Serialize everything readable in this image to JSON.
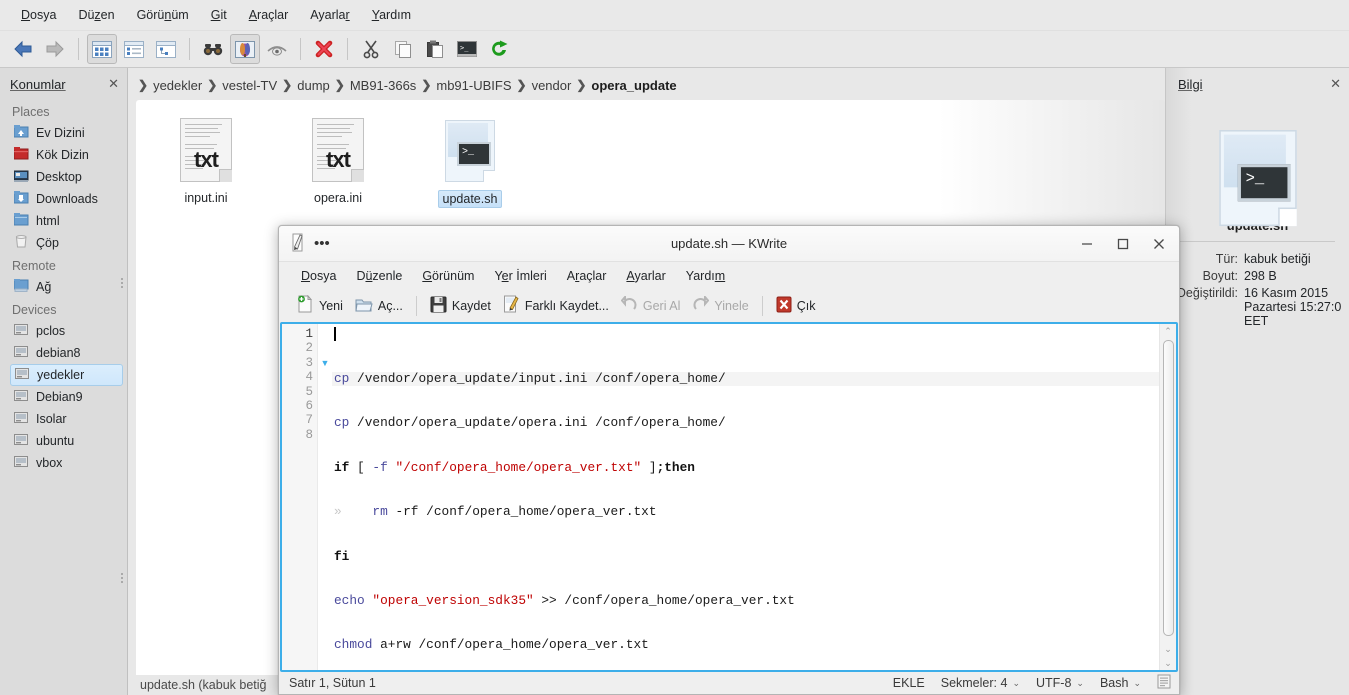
{
  "filemanager": {
    "menubar": [
      "Dosya",
      "Düzen",
      "Görünüm",
      "Git",
      "Araçlar",
      "Ayarlar",
      "Yardım"
    ],
    "toolbar_icons": [
      "back-arrow-icon",
      "forward-arrow-icon",
      "view-icons-icon",
      "view-details-icon",
      "view-columns-icon",
      "find-icon",
      "preview-icon",
      "hidden-files-icon",
      "delete-icon",
      "cut-icon",
      "copy-icon",
      "paste-icon",
      "terminal-icon",
      "reload-icon"
    ],
    "sidebar": {
      "title": "Konumlar",
      "close_label": "✕",
      "groups": [
        {
          "label": "Places",
          "items": [
            {
              "label": "Ev Dizini",
              "icon": "home-folder-icon"
            },
            {
              "label": "Kök Dizin",
              "icon": "root-folder-icon"
            },
            {
              "label": "Desktop",
              "icon": "desktop-folder-icon"
            },
            {
              "label": "Downloads",
              "icon": "downloads-folder-icon"
            },
            {
              "label": "html",
              "icon": "folder-icon"
            },
            {
              "label": "Çöp",
              "icon": "trash-icon"
            }
          ]
        },
        {
          "label": "Remote",
          "items": [
            {
              "label": "Ağ",
              "icon": "network-folder-icon"
            }
          ]
        },
        {
          "label": "Devices",
          "items": [
            {
              "label": "pclos",
              "icon": "harddisk-icon"
            },
            {
              "label": "debian8",
              "icon": "harddisk-icon"
            },
            {
              "label": "yedekler",
              "icon": "harddisk-icon",
              "active": true
            },
            {
              "label": "Debian9",
              "icon": "harddisk-icon"
            },
            {
              "label": "Isolar",
              "icon": "harddisk-icon"
            },
            {
              "label": "ubuntu",
              "icon": "harddisk-icon"
            },
            {
              "label": "vbox",
              "icon": "harddisk-icon"
            }
          ]
        }
      ]
    },
    "breadcrumb": [
      "yedekler",
      "vestel-TV",
      "dump",
      "MB91-366s",
      "mb91-UBIFS",
      "vendor",
      "opera_update"
    ],
    "files": [
      {
        "name": "input.ini",
        "icon": "text-file-icon",
        "badge": "txt",
        "selected": false
      },
      {
        "name": "opera.ini",
        "icon": "text-file-icon",
        "badge": "txt",
        "selected": false
      },
      {
        "name": "update.sh",
        "icon": "shell-script-icon",
        "selected": true
      }
    ],
    "statusbar": "update.sh (kabuk betiğ",
    "infopanel": {
      "title": "Bilgi",
      "close_label": "✕",
      "preview_icon": "shell-script-icon",
      "filename": "update.sh",
      "rows": [
        {
          "key": "Tür:",
          "value": "kabuk betiği"
        },
        {
          "key": "Boyut:",
          "value": "298 B"
        },
        {
          "key": "Değiştirildi:",
          "value": "16 Kasım 2015 Pazartesi 15:27:0 EET"
        }
      ]
    }
  },
  "kwrite": {
    "title": "update.sh — KWrite",
    "titlebar_icons": {
      "app": "kwrite-pencil-icon",
      "menu": "overflow-menu-icon",
      "minimize": "minimize-icon",
      "maximize": "maximize-icon",
      "close": "close-icon"
    },
    "menubar": [
      "Dosya",
      "Düzenle",
      "Görünüm",
      "Yer İmleri",
      "Araçlar",
      "Ayarlar",
      "Yardım"
    ],
    "toolbar": [
      {
        "label": "Yeni",
        "icon": "new-document-icon",
        "enabled": true
      },
      {
        "label": "Aç...",
        "icon": "open-folder-icon",
        "enabled": true
      },
      {
        "label": "Kaydet",
        "icon": "save-floppy-icon",
        "enabled": true
      },
      {
        "label": "Farklı Kaydet...",
        "icon": "save-as-icon",
        "enabled": true
      },
      {
        "label": "Geri Al",
        "icon": "undo-icon",
        "enabled": false
      },
      {
        "label": "Yinele",
        "icon": "redo-icon",
        "enabled": false
      },
      {
        "label": "Çık",
        "icon": "quit-icon",
        "enabled": true
      }
    ],
    "editor": {
      "line_count": 8,
      "current_line": 1,
      "fold_marker_line": 3,
      "lines": [
        {
          "n": 1,
          "tokens": [
            {
              "t": "cp",
              "c": "cmd"
            },
            {
              "t": " /vendor/opera_update/input.ini /conf/opera_home/",
              "c": "plain"
            }
          ]
        },
        {
          "n": 2,
          "tokens": [
            {
              "t": "cp",
              "c": "cmd"
            },
            {
              "t": " /vendor/opera_update/opera.ini /conf/opera_home/",
              "c": "plain"
            }
          ]
        },
        {
          "n": 3,
          "tokens": [
            {
              "t": "if",
              "c": "kw"
            },
            {
              "t": " [ ",
              "c": "plain"
            },
            {
              "t": "-f",
              "c": "cmd"
            },
            {
              "t": " ",
              "c": "plain"
            },
            {
              "t": "\"/conf/opera_home/opera_ver.txt\"",
              "c": "str"
            },
            {
              "t": " ]",
              "c": "plain"
            },
            {
              "t": ";",
              "c": "op"
            },
            {
              "t": "then",
              "c": "kw"
            }
          ]
        },
        {
          "n": 4,
          "tokens": [
            {
              "t": "»",
              "c": "tab"
            },
            {
              "t": "    ",
              "c": "plain"
            },
            {
              "t": "rm",
              "c": "cmd"
            },
            {
              "t": " -rf /conf/opera_home/opera_ver.txt",
              "c": "plain"
            }
          ]
        },
        {
          "n": 5,
          "tokens": [
            {
              "t": "fi",
              "c": "kw"
            }
          ]
        },
        {
          "n": 6,
          "tokens": [
            {
              "t": "echo",
              "c": "cmd"
            },
            {
              "t": " ",
              "c": "plain"
            },
            {
              "t": "\"opera_version_sdk35\"",
              "c": "str"
            },
            {
              "t": " >> /conf/opera_home/opera_ver.txt",
              "c": "plain"
            }
          ]
        },
        {
          "n": 7,
          "tokens": [
            {
              "t": "chmod",
              "c": "cmd"
            },
            {
              "t": " a+rw /conf/opera_home/opera_ver.txt",
              "c": "plain"
            }
          ]
        },
        {
          "n": 8,
          "tokens": []
        }
      ]
    },
    "statusbar": {
      "cursor": "Satır 1, Sütun 1",
      "insert_mode": "EKLE",
      "tabs": "Sekmeler: 4",
      "encoding": "UTF-8",
      "highlight": "Bash",
      "doc_icon": "document-mode-icon",
      "chevron": "⌄"
    }
  },
  "colors": {
    "accent": "#3daee9",
    "window_bg": "#efefef",
    "sidebar_bg": "#dcdcdc",
    "selection": "#cfe7fb",
    "syntax_command": "#4a4a9c",
    "syntax_string": "#bf0303",
    "syntax_keyword": "#121212",
    "delete_red": "#cc2222"
  }
}
